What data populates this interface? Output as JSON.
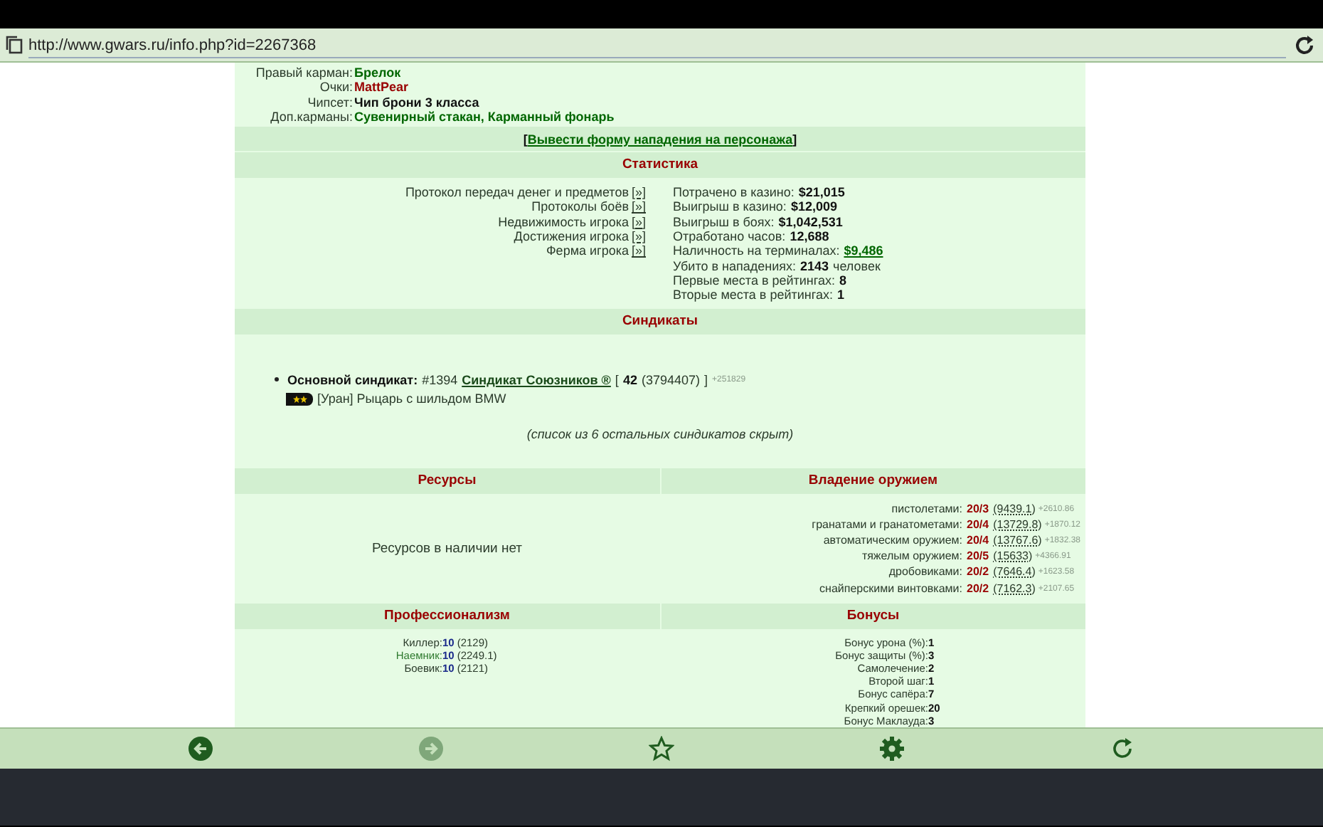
{
  "address_bar": {
    "url": "http://www.gwars.ru/info.php?id=2267368"
  },
  "equipment": [
    {
      "label": "Правый карман:",
      "value": "Брелок",
      "kind": "link"
    },
    {
      "label": "Очки:",
      "value": "MattPear",
      "kind": "special"
    },
    {
      "label": "Чипсет:",
      "value": "Чип брони 3 класса",
      "kind": "plain"
    },
    {
      "label": "Доп.карманы:",
      "value": "Сувенирный стакан, Карманный фонарь",
      "kind": "link"
    }
  ],
  "attack_link": {
    "open": "[",
    "label": "Вывести форму нападения на персонажа",
    "close": "]"
  },
  "statistics": {
    "title": "Статистика",
    "links": [
      {
        "label": "Протокол передач денег и предметов",
        "button": "[»]"
      },
      {
        "label": "Протоколы боёв",
        "button": "[»]"
      },
      {
        "label": "Недвижимость игрока",
        "button": "[»]"
      },
      {
        "label": "Достижения игрока",
        "button": "[»]"
      },
      {
        "label": "Ферма игрока",
        "button": "[»]"
      }
    ],
    "facts": [
      {
        "label": "Потрачено в казино:",
        "value": "$21,015",
        "kind": "plain"
      },
      {
        "label": "Выигрыш в казино:",
        "value": "$12,009",
        "kind": "plain"
      },
      {
        "label": "Выигрыш в боях:",
        "value": "$1,042,531",
        "kind": "plain"
      },
      {
        "label": "Отработано часов:",
        "value": "12,688",
        "kind": "plain"
      },
      {
        "label": "Наличность на терминалах:",
        "value": "$9,486",
        "kind": "link"
      },
      {
        "label": "Убито в нападениях:",
        "value": "2143",
        "suffix": "человек",
        "kind": "plain"
      },
      {
        "label": "Первые места в рейтингах:",
        "value": "8",
        "kind": "plain"
      },
      {
        "label": "Вторые места в рейтингах:",
        "value": "1",
        "kind": "plain"
      }
    ]
  },
  "syndicates": {
    "title": "Синдикаты",
    "main": {
      "label": "Основной синдикат:",
      "number": "#1394",
      "name": "Синдикат Союзников ®",
      "open": "[",
      "rank": "42",
      "points": "(3794407)",
      "close": "]",
      "delta": "+251829"
    },
    "rank_title": "[Уран] Рыцарь с шильдом BMW",
    "hidden_note": "(список из 6 остальных синдикатов скрыт)"
  },
  "resources": {
    "title": "Ресурсы",
    "text": "Ресурсов в наличии нет"
  },
  "weapons": {
    "title": "Владение оружием",
    "rows": [
      {
        "label": "пистолетами:",
        "grade": "20/3",
        "points": "(9439.1)",
        "delta": "+2610.86"
      },
      {
        "label": "гранатами и гранатометами:",
        "grade": "20/4",
        "points": "(13729.8)",
        "delta": "+1870.12"
      },
      {
        "label": "автоматическим оружием:",
        "grade": "20/4",
        "points": "(13767.6)",
        "delta": "+1832.38"
      },
      {
        "label": "тяжелым оружием:",
        "grade": "20/5",
        "points": "(15633)",
        "delta": "+4366.91"
      },
      {
        "label": "дробовиками:",
        "grade": "20/2",
        "points": "(7646.4)",
        "delta": "+1623.58"
      },
      {
        "label": "снайперскими винтовками:",
        "grade": "20/2",
        "points": "(7162.3)",
        "delta": "+2107.65"
      }
    ]
  },
  "professionalism": {
    "title": "Профессионализм",
    "rows": [
      {
        "label": "Киллер:",
        "rank": "10",
        "points": "(2129)",
        "highlighted": false
      },
      {
        "label": "Наемник:",
        "rank": "10",
        "points": "(2249.1)",
        "highlighted": true
      },
      {
        "label": "Боевик:",
        "rank": "10",
        "points": "(2121)",
        "highlighted": false
      }
    ]
  },
  "bonuses": {
    "title": "Бонусы",
    "rows": [
      {
        "label": "Бонус урона (%):",
        "value": "1"
      },
      {
        "label": "Бонус защиты (%):",
        "value": "3"
      },
      {
        "label": "Самолечение:",
        "value": "2"
      },
      {
        "label": "Второй шаг:",
        "value": "1"
      },
      {
        "label": "Бонус сапёра:",
        "value": "7"
      },
      {
        "label": "Крепкий орешек:",
        "value": "20"
      },
      {
        "label": "Бонус Маклауда:",
        "value": "3"
      }
    ]
  },
  "toolbar": [
    {
      "kind": "back",
      "disabled": false
    },
    {
      "kind": "forward",
      "disabled": true
    },
    {
      "kind": "bookmark",
      "disabled": false
    },
    {
      "kind": "settings",
      "disabled": false
    },
    {
      "kind": "reload",
      "disabled": false
    }
  ]
}
